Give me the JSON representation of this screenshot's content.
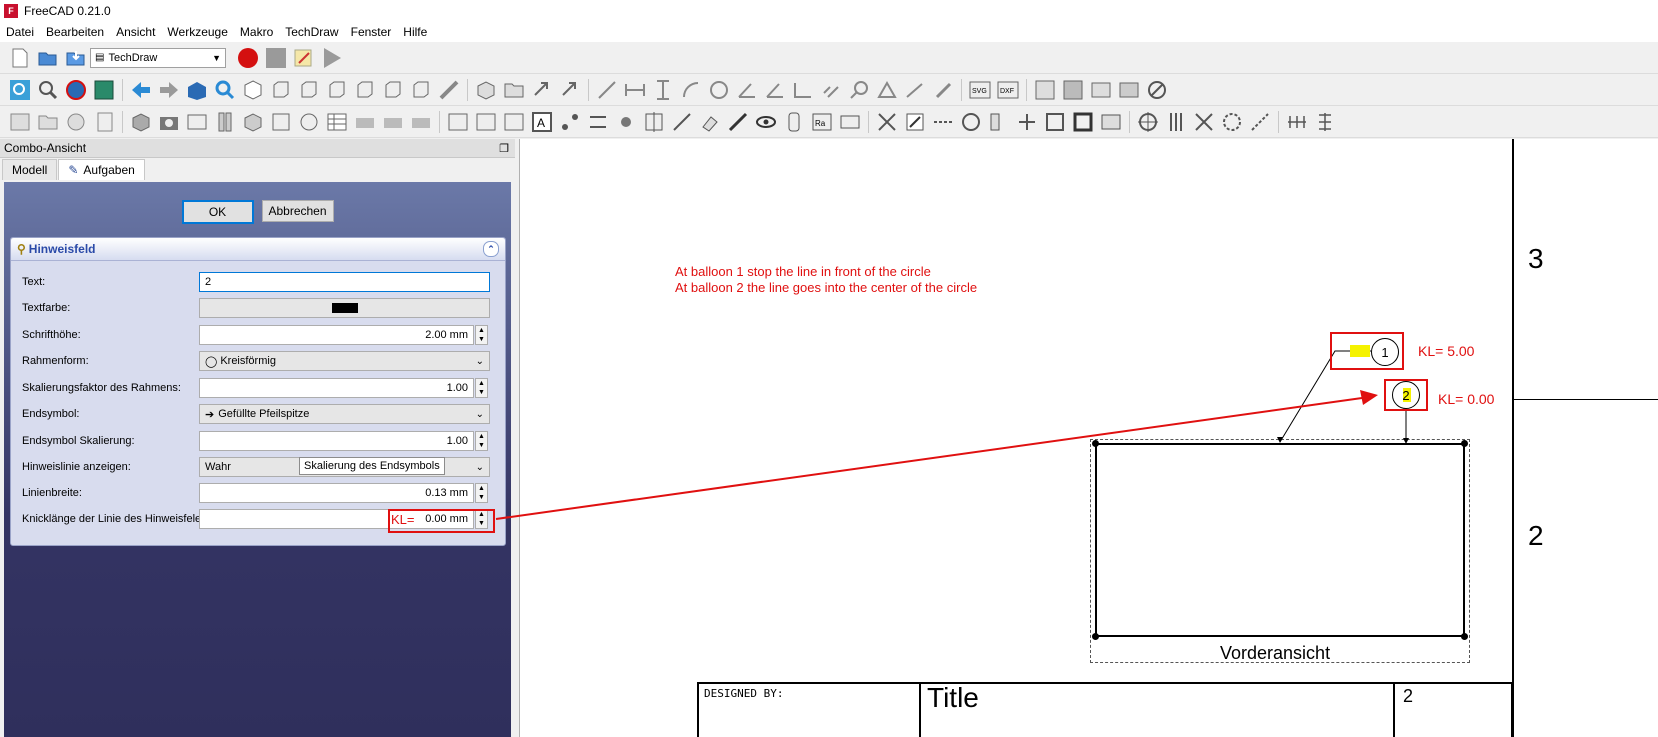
{
  "app": {
    "title": "FreeCAD 0.21.0",
    "logo_icon": "freecad-logo-icon"
  },
  "menu": [
    "Datei",
    "Bearbeiten",
    "Ansicht",
    "Werkzeuge",
    "Makro",
    "TechDraw",
    "Fenster",
    "Hilfe"
  ],
  "toolbar": {
    "workbench": "TechDraw"
  },
  "combo": {
    "title": "Combo-Ansicht",
    "tabs": [
      "Modell",
      "Aufgaben"
    ],
    "ok_label": "OK",
    "cancel_label": "Abbrechen"
  },
  "balloon_panel": {
    "title": "Hinweisfeld",
    "rows": {
      "text": {
        "label": "Text:",
        "value": "2"
      },
      "textcolor": {
        "label": "Textfarbe:"
      },
      "fontsize": {
        "label": "Schrifthöhe:",
        "value": "2.00 mm"
      },
      "shape": {
        "label": "Rahmenform:",
        "value": "Kreisförmig"
      },
      "scale": {
        "label": "Skalierungsfaktor des Rahmens:",
        "value": "1.00"
      },
      "endsymbol": {
        "label": "Endsymbol:",
        "value": "Gefüllte Pfeilspitze"
      },
      "endscale": {
        "label": "Endsymbol Skalierung:",
        "value": "1.00"
      },
      "showline": {
        "label": "Hinweislinie anzeigen:",
        "value": "Wahr"
      },
      "linewidth": {
        "label": "Linienbreite:",
        "value": "0.13 mm"
      },
      "kink": {
        "label": "Knicklänge der Linie des Hinweisfeles:",
        "prefix": "KL=",
        "value": "0.00 mm"
      }
    },
    "tooltip": "Skalierung des Endsymbols"
  },
  "drawing": {
    "note_line1": "At balloon 1 stop the line in front of the circle",
    "note_line2": "At balloon 2 the line goes into the center of the circle",
    "balloon1": "1",
    "balloon2": "2",
    "kl1": "KL= 5.00",
    "kl2": "KL= 0.00",
    "view_label": "Vorderansicht",
    "zone3": "3",
    "zone2": "2",
    "designed_by": "DESIGNED BY:",
    "title_partial": "Title",
    "sheet_partial": "2"
  },
  "colors": {
    "annotation_red": "#e01010",
    "highlight_yellow": "#f5f200",
    "panel_blue": "#343463"
  }
}
